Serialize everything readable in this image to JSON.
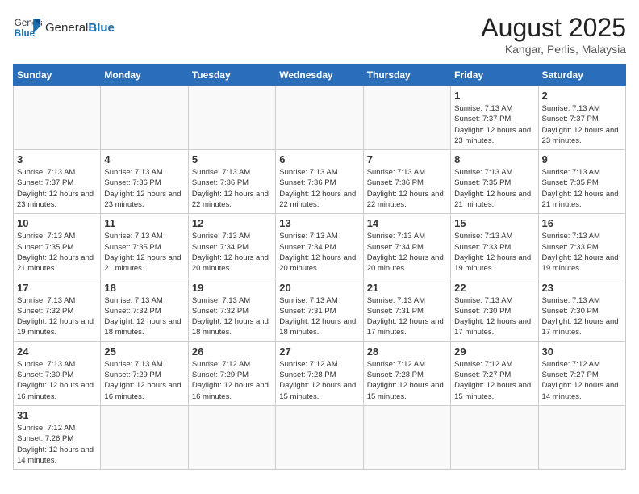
{
  "header": {
    "logo_general": "General",
    "logo_blue": "Blue",
    "month_title": "August 2025",
    "location": "Kangar, Perlis, Malaysia"
  },
  "days_of_week": [
    "Sunday",
    "Monday",
    "Tuesday",
    "Wednesday",
    "Thursday",
    "Friday",
    "Saturday"
  ],
  "weeks": [
    [
      {
        "day": "",
        "info": ""
      },
      {
        "day": "",
        "info": ""
      },
      {
        "day": "",
        "info": ""
      },
      {
        "day": "",
        "info": ""
      },
      {
        "day": "",
        "info": ""
      },
      {
        "day": "1",
        "info": "Sunrise: 7:13 AM\nSunset: 7:37 PM\nDaylight: 12 hours\nand 23 minutes."
      },
      {
        "day": "2",
        "info": "Sunrise: 7:13 AM\nSunset: 7:37 PM\nDaylight: 12 hours\nand 23 minutes."
      }
    ],
    [
      {
        "day": "3",
        "info": "Sunrise: 7:13 AM\nSunset: 7:37 PM\nDaylight: 12 hours\nand 23 minutes."
      },
      {
        "day": "4",
        "info": "Sunrise: 7:13 AM\nSunset: 7:36 PM\nDaylight: 12 hours\nand 23 minutes."
      },
      {
        "day": "5",
        "info": "Sunrise: 7:13 AM\nSunset: 7:36 PM\nDaylight: 12 hours\nand 22 minutes."
      },
      {
        "day": "6",
        "info": "Sunrise: 7:13 AM\nSunset: 7:36 PM\nDaylight: 12 hours\nand 22 minutes."
      },
      {
        "day": "7",
        "info": "Sunrise: 7:13 AM\nSunset: 7:36 PM\nDaylight: 12 hours\nand 22 minutes."
      },
      {
        "day": "8",
        "info": "Sunrise: 7:13 AM\nSunset: 7:35 PM\nDaylight: 12 hours\nand 21 minutes."
      },
      {
        "day": "9",
        "info": "Sunrise: 7:13 AM\nSunset: 7:35 PM\nDaylight: 12 hours\nand 21 minutes."
      }
    ],
    [
      {
        "day": "10",
        "info": "Sunrise: 7:13 AM\nSunset: 7:35 PM\nDaylight: 12 hours\nand 21 minutes."
      },
      {
        "day": "11",
        "info": "Sunrise: 7:13 AM\nSunset: 7:35 PM\nDaylight: 12 hours\nand 21 minutes."
      },
      {
        "day": "12",
        "info": "Sunrise: 7:13 AM\nSunset: 7:34 PM\nDaylight: 12 hours\nand 20 minutes."
      },
      {
        "day": "13",
        "info": "Sunrise: 7:13 AM\nSunset: 7:34 PM\nDaylight: 12 hours\nand 20 minutes."
      },
      {
        "day": "14",
        "info": "Sunrise: 7:13 AM\nSunset: 7:34 PM\nDaylight: 12 hours\nand 20 minutes."
      },
      {
        "day": "15",
        "info": "Sunrise: 7:13 AM\nSunset: 7:33 PM\nDaylight: 12 hours\nand 19 minutes."
      },
      {
        "day": "16",
        "info": "Sunrise: 7:13 AM\nSunset: 7:33 PM\nDaylight: 12 hours\nand 19 minutes."
      }
    ],
    [
      {
        "day": "17",
        "info": "Sunrise: 7:13 AM\nSunset: 7:32 PM\nDaylight: 12 hours\nand 19 minutes."
      },
      {
        "day": "18",
        "info": "Sunrise: 7:13 AM\nSunset: 7:32 PM\nDaylight: 12 hours\nand 18 minutes."
      },
      {
        "day": "19",
        "info": "Sunrise: 7:13 AM\nSunset: 7:32 PM\nDaylight: 12 hours\nand 18 minutes."
      },
      {
        "day": "20",
        "info": "Sunrise: 7:13 AM\nSunset: 7:31 PM\nDaylight: 12 hours\nand 18 minutes."
      },
      {
        "day": "21",
        "info": "Sunrise: 7:13 AM\nSunset: 7:31 PM\nDaylight: 12 hours\nand 17 minutes."
      },
      {
        "day": "22",
        "info": "Sunrise: 7:13 AM\nSunset: 7:30 PM\nDaylight: 12 hours\nand 17 minutes."
      },
      {
        "day": "23",
        "info": "Sunrise: 7:13 AM\nSunset: 7:30 PM\nDaylight: 12 hours\nand 17 minutes."
      }
    ],
    [
      {
        "day": "24",
        "info": "Sunrise: 7:13 AM\nSunset: 7:30 PM\nDaylight: 12 hours\nand 16 minutes."
      },
      {
        "day": "25",
        "info": "Sunrise: 7:13 AM\nSunset: 7:29 PM\nDaylight: 12 hours\nand 16 minutes."
      },
      {
        "day": "26",
        "info": "Sunrise: 7:12 AM\nSunset: 7:29 PM\nDaylight: 12 hours\nand 16 minutes."
      },
      {
        "day": "27",
        "info": "Sunrise: 7:12 AM\nSunset: 7:28 PM\nDaylight: 12 hours\nand 15 minutes."
      },
      {
        "day": "28",
        "info": "Sunrise: 7:12 AM\nSunset: 7:28 PM\nDaylight: 12 hours\nand 15 minutes."
      },
      {
        "day": "29",
        "info": "Sunrise: 7:12 AM\nSunset: 7:27 PM\nDaylight: 12 hours\nand 15 minutes."
      },
      {
        "day": "30",
        "info": "Sunrise: 7:12 AM\nSunset: 7:27 PM\nDaylight: 12 hours\nand 14 minutes."
      }
    ],
    [
      {
        "day": "31",
        "info": "Sunrise: 7:12 AM\nSunset: 7:26 PM\nDaylight: 12 hours\nand 14 minutes."
      },
      {
        "day": "",
        "info": ""
      },
      {
        "day": "",
        "info": ""
      },
      {
        "day": "",
        "info": ""
      },
      {
        "day": "",
        "info": ""
      },
      {
        "day": "",
        "info": ""
      },
      {
        "day": "",
        "info": ""
      }
    ]
  ]
}
